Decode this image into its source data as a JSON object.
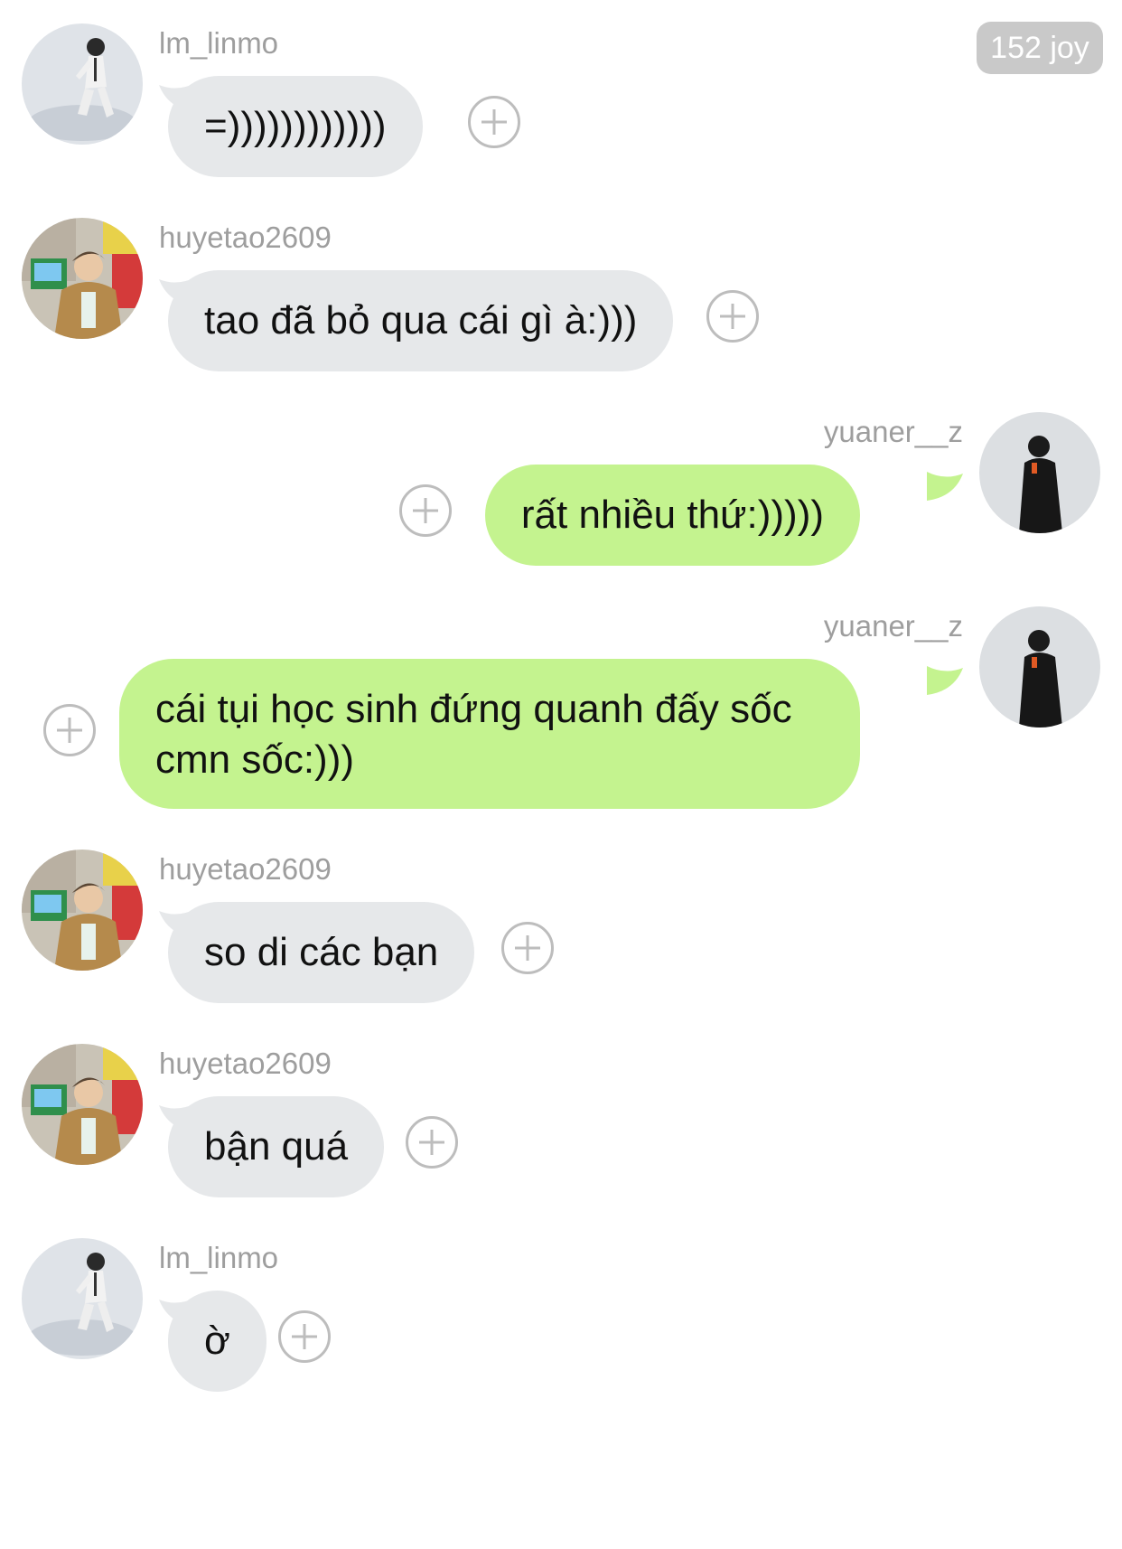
{
  "header": {
    "joy_badge": "152 joy"
  },
  "users": {
    "lm_linmo": "lm_linmo",
    "huyetao": "huyetao2609",
    "yuaner": "yuaner__z"
  },
  "messages": [
    {
      "user": "lm_linmo",
      "side": "left",
      "text": "=))))))))))))"
    },
    {
      "user": "huyetao2609",
      "side": "left",
      "text": "tao đã bỏ qua cái gì à:)))"
    },
    {
      "user": "yuaner__z",
      "side": "right",
      "text": "rất nhiều thứ:)))))"
    },
    {
      "user": "yuaner__z",
      "side": "right",
      "text": "cái tụi học sinh đứng quanh đấy sốc cmn sốc:)))"
    },
    {
      "user": "huyetao2609",
      "side": "left",
      "text": "so di các bạn"
    },
    {
      "user": "huyetao2609",
      "side": "left",
      "text": "bận quá"
    },
    {
      "user": "lm_linmo",
      "side": "left",
      "text": "ờ"
    }
  ],
  "colors": {
    "incoming_bubble": "#e6e8ea",
    "outgoing_bubble": "#c4f38f",
    "username": "#9e9e9e",
    "badge": "#c9c9c9"
  },
  "icons": {
    "react": "plus-circle-icon"
  }
}
